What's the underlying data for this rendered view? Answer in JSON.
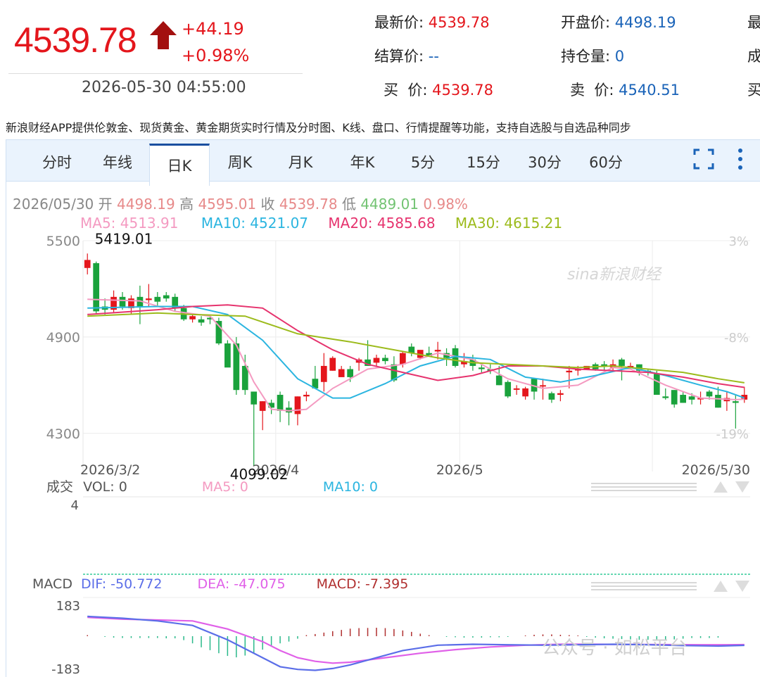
{
  "header": {
    "price": "4539.78",
    "change": "+44.19",
    "change_pct": "+0.98%",
    "datetime": "2026-05-30 04:55:00",
    "up_color": "#e4161c"
  },
  "quote": {
    "latest_label": "最新价:",
    "latest": "4539.78",
    "open_label": "开盘价:",
    "open": "4498.19",
    "settle_label": "结算价:",
    "settle": "--",
    "oi_label": "持仓量:",
    "oi": "0",
    "bid_label": "买  价:",
    "bid": "4539.78",
    "ask_label": "卖  价:",
    "ask": "4540.51",
    "cut_1": "最",
    "cut_2": "成",
    "cut_3": "买"
  },
  "promo": "新浪财经APP提供伦敦金、现货黄金、黄金期货实时行情及分时图、K线、盘口、行情提醒等功能，支持自选股与自选品种同步",
  "tabs": [
    "分时",
    "年线",
    "日K",
    "周K",
    "月K",
    "年K",
    "5分",
    "15分",
    "30分",
    "60分"
  ],
  "active_tab": "日K",
  "ohlc": {
    "date": "2026/05/30",
    "open_label": "开",
    "open": "4498.19",
    "high_label": "高",
    "high": "4595.01",
    "close_label": "收",
    "close": "4539.78",
    "low_label": "低",
    "low": "4489.01",
    "pct": "0.98%"
  },
  "ma": {
    "ma5": "MA5: 4513.91",
    "ma10": "MA10: 4521.07",
    "ma20": "MA20: 4585.68",
    "ma30": "MA30: 4615.21",
    "ma5_color": "#f49ac1",
    "ma10_color": "#2bb5e0",
    "ma20_color": "#e6336e",
    "ma30_color": "#9cbb1c"
  },
  "volume": {
    "label": "成交",
    "vol": "VOL: 0",
    "ma5": "MA5: 0",
    "ma10": "MA10: 0",
    "ymax": "4"
  },
  "macd": {
    "label": "MACD",
    "dif": "DIF: -50.772",
    "dea": "DEA: -47.075",
    "macd": "MACD: -7.395",
    "ymax": "183",
    "ymin": "-183"
  },
  "watermark": {
    "brand": "sina新浪财经",
    "bottom": "公众号 · 如松平台"
  },
  "chart_data": {
    "type": "candlestick",
    "y_ticks": [
      "5500",
      "4900",
      "4300"
    ],
    "pct_ticks": [
      "3%",
      "-8%",
      "-19%"
    ],
    "x_ticks": [
      "2026/3/2",
      "2026/4",
      "2026/5",
      "2026/5/30"
    ],
    "max_label": "5419.01",
    "min_label": "4099.02",
    "ylim": [
      4150,
      5500
    ],
    "candles": [
      [
        5330,
        5420,
        5290,
        5380
      ],
      [
        5360,
        5370,
        5040,
        5060
      ],
      [
        5090,
        5140,
        5040,
        5070
      ],
      [
        5070,
        5190,
        5050,
        5150
      ],
      [
        5150,
        5180,
        5070,
        5090
      ],
      [
        5080,
        5160,
        5040,
        5140
      ],
      [
        5150,
        5220,
        4980,
        5090
      ],
      [
        5130,
        5230,
        5090,
        5140
      ],
      [
        5150,
        5180,
        5090,
        5120
      ],
      [
        5160,
        5180,
        5120,
        5140
      ],
      [
        5150,
        5170,
        5060,
        5080
      ],
      [
        5080,
        5100,
        5000,
        5010
      ],
      [
        5010,
        5040,
        4990,
        5030
      ],
      [
        5010,
        5030,
        4970,
        4990
      ],
      [
        5020,
        5040,
        4980,
        5010
      ],
      [
        5000,
        5020,
        4850,
        4860
      ],
      [
        4860,
        4880,
        4720,
        4710
      ],
      [
        4860,
        4900,
        4540,
        4570
      ],
      [
        4720,
        4790,
        4540,
        4570
      ],
      [
        4560,
        4560,
        4100,
        4480
      ],
      [
        4440,
        4500,
        4320,
        4500
      ],
      [
        4490,
        4510,
        4420,
        4460
      ],
      [
        4540,
        4560,
        4370,
        4440
      ],
      [
        4460,
        4500,
        4350,
        4430
      ],
      [
        4420,
        4530,
        4350,
        4530
      ],
      [
        4530,
        4560,
        4500,
        4540
      ],
      [
        4640,
        4720,
        4590,
        4580
      ],
      [
        4620,
        4800,
        4560,
        4720
      ],
      [
        4690,
        4780,
        4690,
        4770
      ],
      [
        4650,
        4720,
        4660,
        4700
      ],
      [
        4700,
        4720,
        4620,
        4650
      ],
      [
        4740,
        4770,
        4690,
        4760
      ],
      [
        4760,
        4880,
        4720,
        4720
      ],
      [
        4740,
        4790,
        4720,
        4770
      ],
      [
        4770,
        4790,
        4730,
        4750
      ],
      [
        4730,
        4780,
        4620,
        4630
      ],
      [
        4730,
        4810,
        4710,
        4800
      ],
      [
        4840,
        4860,
        4780,
        4800
      ],
      [
        4770,
        4810,
        4760,
        4820
      ],
      [
        4800,
        4840,
        4780,
        4780
      ],
      [
        4810,
        4870,
        4760,
        4820
      ],
      [
        4800,
        4830,
        4720,
        4770
      ],
      [
        4830,
        4850,
        4710,
        4720
      ],
      [
        4730,
        4800,
        4710,
        4750
      ],
      [
        4760,
        4790,
        4690,
        4720
      ],
      [
        4710,
        4740,
        4680,
        4700
      ],
      [
        4700,
        4730,
        4670,
        4690
      ],
      [
        4660,
        4720,
        4600,
        4600
      ],
      [
        4620,
        4630,
        4520,
        4530
      ],
      [
        4580,
        4600,
        4540,
        4580
      ],
      [
        4530,
        4590,
        4510,
        4580
      ],
      [
        4640,
        4640,
        4510,
        4560
      ],
      [
        4600,
        4640,
        4510,
        4600
      ],
      [
        4550,
        4560,
        4490,
        4510
      ],
      [
        4540,
        4570,
        4500,
        4550
      ],
      [
        4680,
        4720,
        4580,
        4690
      ],
      [
        4700,
        4720,
        4660,
        4700
      ],
      [
        4700,
        4720,
        4700,
        4720
      ],
      [
        4730,
        4740,
        4690,
        4700
      ],
      [
        4730,
        4750,
        4690,
        4720
      ],
      [
        4710,
        4760,
        4690,
        4730
      ],
      [
        4760,
        4770,
        4630,
        4720
      ],
      [
        4720,
        4740,
        4700,
        4720
      ],
      [
        4730,
        4730,
        4660,
        4690
      ],
      [
        4690,
        4700,
        4660,
        4680
      ],
      [
        4670,
        4690,
        4540,
        4540
      ],
      [
        4530,
        4580,
        4510,
        4520
      ],
      [
        4570,
        4570,
        4460,
        4480
      ],
      [
        4540,
        4560,
        4490,
        4490
      ],
      [
        4530,
        4550,
        4480,
        4510
      ],
      [
        4520,
        4560,
        4480,
        4520
      ],
      [
        4560,
        4570,
        4510,
        4530
      ],
      [
        4540,
        4590,
        4460,
        4460
      ],
      [
        4500,
        4560,
        4440,
        4520
      ],
      [
        4500,
        4540,
        4330,
        4490
      ],
      [
        4510,
        4590,
        4490,
        4540
      ]
    ],
    "ma_series": [
      {
        "name": "MA5",
        "color": "#f49ac1",
        "points": [
          [
            0,
            5135
          ],
          [
            6,
            5125
          ],
          [
            10,
            5060
          ],
          [
            14,
            5030
          ],
          [
            17,
            4850
          ],
          [
            19,
            4620
          ],
          [
            21,
            4450
          ],
          [
            23,
            4440
          ],
          [
            25,
            4450
          ],
          [
            28,
            4580
          ],
          [
            32,
            4700
          ],
          [
            36,
            4730
          ],
          [
            40,
            4800
          ],
          [
            44,
            4760
          ],
          [
            48,
            4640
          ],
          [
            52,
            4580
          ],
          [
            56,
            4600
          ],
          [
            60,
            4710
          ],
          [
            62,
            4700
          ],
          [
            66,
            4600
          ],
          [
            70,
            4520
          ],
          [
            74,
            4510
          ],
          [
            75,
            4513
          ]
        ]
      },
      {
        "name": "MA10",
        "color": "#2bb5e0",
        "points": [
          [
            0,
            5080
          ],
          [
            8,
            5090
          ],
          [
            12,
            5090
          ],
          [
            16,
            5040
          ],
          [
            20,
            4880
          ],
          [
            24,
            4640
          ],
          [
            28,
            4520
          ],
          [
            30,
            4520
          ],
          [
            34,
            4610
          ],
          [
            38,
            4720
          ],
          [
            42,
            4780
          ],
          [
            46,
            4760
          ],
          [
            50,
            4650
          ],
          [
            54,
            4620
          ],
          [
            58,
            4660
          ],
          [
            62,
            4710
          ],
          [
            66,
            4660
          ],
          [
            70,
            4600
          ],
          [
            73,
            4560
          ],
          [
            75,
            4521
          ]
        ]
      },
      {
        "name": "MA20",
        "color": "#e6336e",
        "points": [
          [
            0,
            5040
          ],
          [
            8,
            5070
          ],
          [
            12,
            5090
          ],
          [
            16,
            5100
          ],
          [
            20,
            5080
          ],
          [
            24,
            4940
          ],
          [
            28,
            4820
          ],
          [
            32,
            4730
          ],
          [
            36,
            4680
          ],
          [
            40,
            4630
          ],
          [
            44,
            4660
          ],
          [
            48,
            4720
          ],
          [
            52,
            4720
          ],
          [
            56,
            4700
          ],
          [
            60,
            4690
          ],
          [
            64,
            4680
          ],
          [
            68,
            4650
          ],
          [
            72,
            4610
          ],
          [
            75,
            4586
          ]
        ]
      },
      {
        "name": "MA30",
        "color": "#9cbb1c",
        "points": [
          [
            0,
            5030
          ],
          [
            8,
            5050
          ],
          [
            12,
            5040
          ],
          [
            18,
            5030
          ],
          [
            24,
            4920
          ],
          [
            30,
            4870
          ],
          [
            36,
            4810
          ],
          [
            40,
            4770
          ],
          [
            44,
            4740
          ],
          [
            48,
            4730
          ],
          [
            52,
            4720
          ],
          [
            56,
            4710
          ],
          [
            60,
            4720
          ],
          [
            64,
            4700
          ],
          [
            68,
            4680
          ],
          [
            72,
            4640
          ],
          [
            75,
            4615
          ]
        ]
      }
    ],
    "macd_hist": [
      6,
      0,
      -4,
      -8,
      -10,
      -10,
      -10,
      -10,
      -10,
      -12,
      -12,
      -22,
      -40,
      -62,
      -78,
      -95,
      -110,
      -118,
      -108,
      -95,
      -75,
      -55,
      -40,
      -30,
      -14,
      6,
      12,
      20,
      28,
      35,
      42,
      45,
      46,
      47,
      45,
      40,
      32,
      24,
      14,
      6,
      0,
      -4,
      -6,
      -8,
      -8,
      -8,
      -6,
      -6,
      -4,
      0,
      4,
      8,
      10,
      10,
      8,
      6,
      4,
      -4,
      -8,
      -12,
      -14,
      -16,
      -18,
      -20,
      -20,
      -22,
      -22,
      -18,
      -14,
      -10,
      -10,
      -10,
      -8
    ],
    "dif_points": [
      [
        0,
        110
      ],
      [
        4,
        100
      ],
      [
        8,
        85
      ],
      [
        12,
        60
      ],
      [
        16,
        -20
      ],
      [
        20,
        -120
      ],
      [
        22,
        -170
      ],
      [
        24,
        -185
      ],
      [
        26,
        -190
      ],
      [
        28,
        -180
      ],
      [
        30,
        -160
      ],
      [
        33,
        -120
      ],
      [
        36,
        -80
      ],
      [
        40,
        -50
      ],
      [
        44,
        -45
      ],
      [
        48,
        -48
      ],
      [
        52,
        -50
      ],
      [
        56,
        -48
      ],
      [
        60,
        -45
      ],
      [
        64,
        -48
      ],
      [
        68,
        -52
      ],
      [
        72,
        -55
      ],
      [
        75,
        -51
      ]
    ],
    "dea_points": [
      [
        0,
        105
      ],
      [
        4,
        95
      ],
      [
        8,
        90
      ],
      [
        12,
        85
      ],
      [
        16,
        40
      ],
      [
        20,
        -30
      ],
      [
        22,
        -80
      ],
      [
        24,
        -120
      ],
      [
        26,
        -140
      ],
      [
        28,
        -150
      ],
      [
        30,
        -145
      ],
      [
        34,
        -120
      ],
      [
        38,
        -95
      ],
      [
        42,
        -75
      ],
      [
        46,
        -60
      ],
      [
        50,
        -50
      ],
      [
        54,
        -45
      ],
      [
        58,
        -45
      ],
      [
        62,
        -46
      ],
      [
        66,
        -47
      ],
      [
        70,
        -48
      ],
      [
        73,
        -48
      ],
      [
        75,
        -47
      ]
    ],
    "macd_ylim": [
      -200,
      200
    ]
  }
}
